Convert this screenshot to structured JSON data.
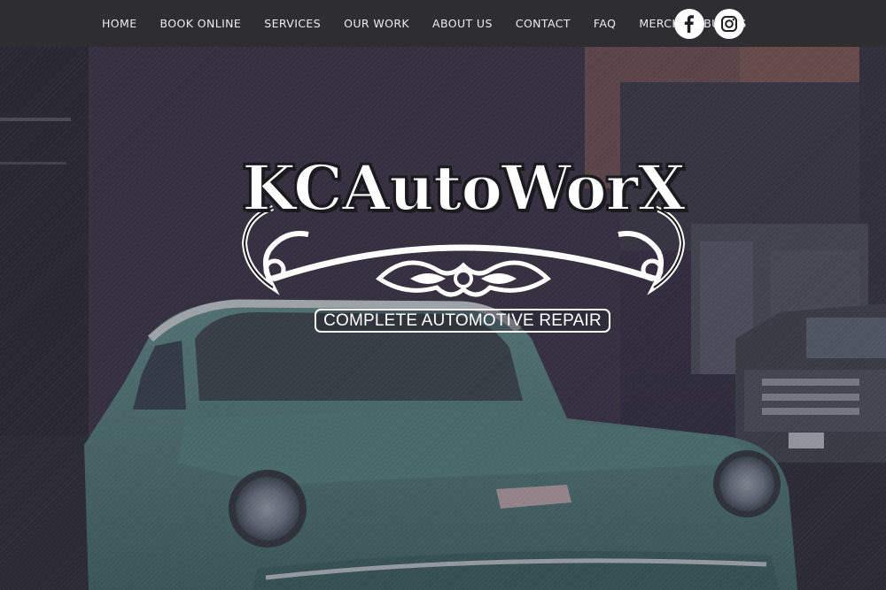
{
  "nav": {
    "items": [
      {
        "label": "HOME"
      },
      {
        "label": "BOOK ONLINE"
      },
      {
        "label": "SERVICES"
      },
      {
        "label": "OUR WORK"
      },
      {
        "label": "ABOUT US"
      },
      {
        "label": "CONTACT"
      },
      {
        "label": "FAQ"
      },
      {
        "label": "MERCH"
      },
      {
        "label": "BUILDS"
      }
    ],
    "social": [
      {
        "icon": "facebook-icon"
      },
      {
        "icon": "instagram-icon"
      }
    ]
  },
  "hero": {
    "logo_text": "KCAutoWorX",
    "tagline": "COMPLETE AUTOMOTIVE REPAIR"
  },
  "colors": {
    "navbar": "#2e2e30",
    "nav_text": "#ededed",
    "car": "#4f7a78",
    "overlay": "#2d2a3a"
  }
}
